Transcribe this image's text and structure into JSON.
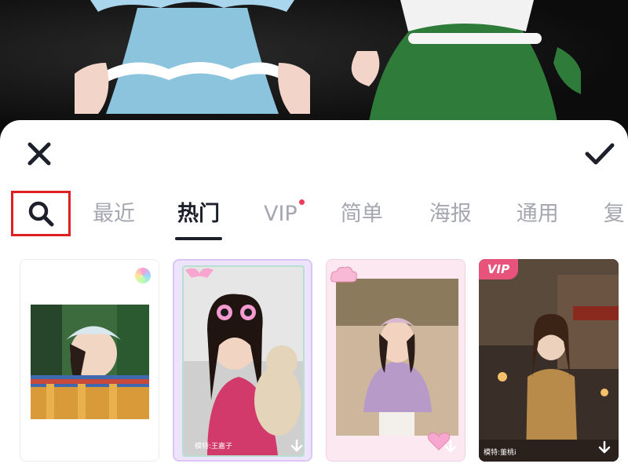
{
  "header": {
    "close_icon": "close-icon",
    "confirm_icon": "check-icon"
  },
  "tabs": {
    "search_icon": "search-icon",
    "items": [
      {
        "label": "最近",
        "active": false,
        "has_dot": false
      },
      {
        "label": "热门",
        "active": true,
        "has_dot": false
      },
      {
        "label": "VIP",
        "active": false,
        "has_dot": true
      },
      {
        "label": "简单",
        "active": false,
        "has_dot": false
      },
      {
        "label": "海报",
        "active": false,
        "has_dot": false
      },
      {
        "label": "通用",
        "active": false,
        "has_dot": false
      },
      {
        "label": "复",
        "active": false,
        "has_dot": false
      }
    ]
  },
  "templates": [
    {
      "type": "plain",
      "badge": "rainbow-badge"
    },
    {
      "type": "frame",
      "model_label": "模特:王嘉子"
    },
    {
      "type": "polaroid"
    },
    {
      "type": "vip",
      "vip_label": "VIP",
      "model_label": "模特:董桃i"
    }
  ],
  "colors": {
    "accent": "#1d1f2b",
    "inactive": "#a5a7b0",
    "highlight_box": "#e02020",
    "vip": "#e8537b",
    "dot": "#f03a5a"
  }
}
